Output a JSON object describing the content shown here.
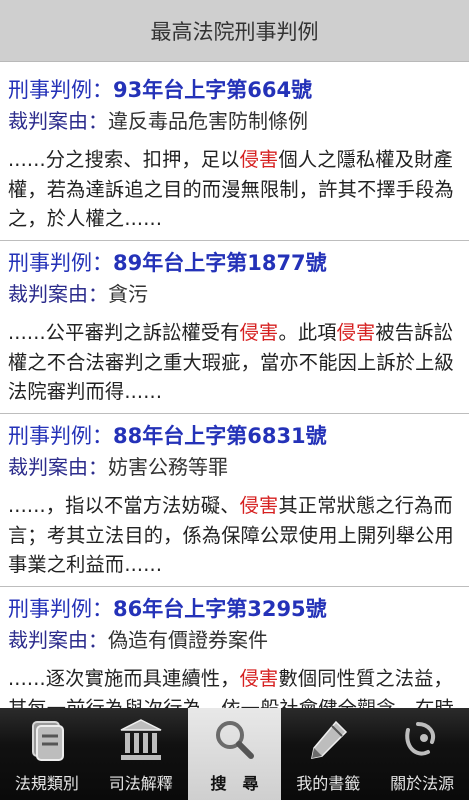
{
  "header": {
    "title": "最高法院刑事判例"
  },
  "items": [
    {
      "title_label": "刑事判例：",
      "title_value": "93年台上字第664號",
      "reason_label": "裁判案由：",
      "reason_value": "違反毒品危害防制條例",
      "snippet_before": "......分之搜索、扣押，足以",
      "snippet_hl": "侵害",
      "snippet_after": "個人之隱私權及財產權，若為達訴追之目的而漫無限制，許其不擇手段為之，於人權之......"
    },
    {
      "title_label": "刑事判例：",
      "title_value": "89年台上字第1877號",
      "reason_label": "裁判案由：",
      "reason_value": "貪污",
      "snippet_before": "......公平審判之訴訟權受有",
      "snippet_hl": "侵害",
      "snippet_mid": "。此項",
      "snippet_hl2": "侵害",
      "snippet_after": "被告訴訟權之不合法審判之重大瑕疵，當亦不能因上訴於上級法院審判而得......"
    },
    {
      "title_label": "刑事判例：",
      "title_value": "88年台上字第6831號",
      "reason_label": "裁判案由：",
      "reason_value": "妨害公務等罪",
      "snippet_before": "......，指以不當方法妨礙、",
      "snippet_hl": "侵害",
      "snippet_after": "其正常狀態之行為而言；考其立法目的，係為保障公眾使用上開列舉公用事業之利益而......"
    },
    {
      "title_label": "刑事判例：",
      "title_value": "86年台上字第3295號",
      "reason_label": "裁判案由：",
      "reason_value": "偽造有價證券案件",
      "snippet_before": "......逐次實施而具連續性，",
      "snippet_hl": "侵害",
      "snippet_after": "數個同性質之法益，其每一前行為與次行為，依一般社會健全觀念，在時間差距上，可......"
    }
  ],
  "tabs": [
    {
      "label": "法規類別",
      "icon": "law-book-icon"
    },
    {
      "label": "司法解釋",
      "icon": "court-building-icon"
    },
    {
      "label": "搜　尋",
      "icon": "search-icon",
      "active": true
    },
    {
      "label": "我的書籤",
      "icon": "pencil-icon"
    },
    {
      "label": "關於法源",
      "icon": "about-logo-icon"
    }
  ],
  "colors": {
    "header_bg": "#cfcfcf",
    "title_blue": "#2432b8",
    "highlight_red": "#d62020",
    "tabbar_bg": "#111111"
  }
}
